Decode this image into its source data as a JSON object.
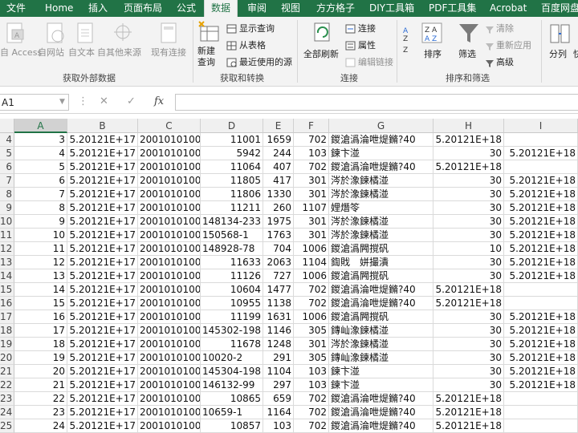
{
  "tabs": [
    "文件",
    "Home",
    "插入",
    "页面布局",
    "公式",
    "数据",
    "审阅",
    "视图",
    "方方格子",
    "DIY工具箱",
    "PDF工具集",
    "Acrobat",
    "百度网盘"
  ],
  "active_tab": "数据",
  "ribbon": {
    "ext_buttons": [
      "自 Access",
      "自网站",
      "自文本",
      "自其他来源",
      "现有连接"
    ],
    "group_external": "获取外部数据",
    "new_query": "新建\n查询",
    "get_cmds": [
      "显示查询",
      "从表格",
      "最近使用的源"
    ],
    "group_get": "获取和转换",
    "refresh_all": "全部刷新",
    "conn_cmds": [
      "连接",
      "属性",
      "编辑链接"
    ],
    "group_conn": "连接",
    "sort": "排序",
    "filter": "筛选",
    "filter_cmds": [
      "清除",
      "重新应用",
      "高级"
    ],
    "group_sort": "排序和筛选",
    "split": "分列",
    "more": "快"
  },
  "formula_bar": {
    "name_box": "A1",
    "fx": "fx",
    "formula": ""
  },
  "columns": [
    "A",
    "B",
    "C",
    "D",
    "E",
    "F",
    "G",
    "H",
    "I"
  ],
  "rows": [
    {
      "n": "4",
      "a": "3",
      "b": "5.20121E+17",
      "c": "2001010100",
      "d": "11001",
      "e": "1659",
      "f": "702",
      "g": "鍐滄潙淪呭煶鏅?40",
      "h": "5.20121E+18",
      "i": ""
    },
    {
      "n": "5",
      "a": "4",
      "b": "5.20121E+17",
      "c": "2001010100",
      "d": "5942",
      "e": "244",
      "f": "103",
      "g": "鍊卞湴",
      "h": "30",
      "i": "5.20121E+18"
    },
    {
      "n": "6",
      "a": "5",
      "b": "5.20121E+17",
      "c": "2001010100",
      "d": "11064",
      "e": "407",
      "f": "702",
      "g": "鍐滄潙淪呭煶鏅?40",
      "h": "5.20121E+18",
      "i": ""
    },
    {
      "n": "7",
      "a": "6",
      "b": "5.20121E+17",
      "c": "2001010100",
      "d": "11805",
      "e": "417",
      "f": "301",
      "g": "涔於潒鍊橘湴",
      "h": "30",
      "i": "5.20121E+18"
    },
    {
      "n": "8",
      "a": "7",
      "b": "5.20121E+17",
      "c": "2001010100",
      "d": "11806",
      "e": "1330",
      "f": "301",
      "g": "涔於潒鍊橘湴",
      "h": "30",
      "i": "5.20121E+18"
    },
    {
      "n": "9",
      "a": "8",
      "b": "5.20121E+17",
      "c": "2001010100",
      "d": "11211",
      "e": "260",
      "f": "1107",
      "g": "娌熸笭",
      "h": "30",
      "i": "5.20121E+18"
    },
    {
      "n": "10",
      "a": "9",
      "b": "5.20121E+17",
      "c": "2001010100",
      "d": "148134-233",
      "e": "1975",
      "f": "301",
      "g": "涔於潒鍊橘湴",
      "h": "30",
      "i": "5.20121E+18"
    },
    {
      "n": "11",
      "a": "10",
      "b": "5.20121E+17",
      "c": "2001010100",
      "d": "150568-1",
      "e": "1763",
      "f": "301",
      "g": "涔於潒鍊橘湴",
      "h": "30",
      "i": "5.20121E+18"
    },
    {
      "n": "12",
      "a": "11",
      "b": "5.20121E+17",
      "c": "2001010100",
      "d": "148928-78",
      "e": "704",
      "f": "1006",
      "g": "鍐滄潙闁撹矾",
      "h": "10",
      "i": "5.20121E+18"
    },
    {
      "n": "13",
      "a": "12",
      "b": "5.20121E+17",
      "c": "2001010100",
      "d": "11633",
      "e": "2063",
      "f": "1104",
      "g": "鍧戝　姘撮潰",
      "h": "30",
      "i": "5.20121E+18"
    },
    {
      "n": "14",
      "a": "13",
      "b": "5.20121E+17",
      "c": "2001010100",
      "d": "11126",
      "e": "727",
      "f": "1006",
      "g": "鍐滄潙闁撹矾",
      "h": "30",
      "i": "5.20121E+18"
    },
    {
      "n": "15",
      "a": "14",
      "b": "5.20121E+17",
      "c": "2001010100",
      "d": "10604",
      "e": "1477",
      "f": "702",
      "g": "鍐滄潙淪呭煶鏅?40",
      "h": "5.20121E+18",
      "i": ""
    },
    {
      "n": "16",
      "a": "15",
      "b": "5.20121E+17",
      "c": "2001010100",
      "d": "10955",
      "e": "1138",
      "f": "702",
      "g": "鍐滄潙淪呭煶鏅?40",
      "h": "5.20121E+18",
      "i": ""
    },
    {
      "n": "17",
      "a": "16",
      "b": "5.20121E+17",
      "c": "2001010100",
      "d": "11199",
      "e": "1631",
      "f": "1006",
      "g": "鍐滄潙闁撹矾",
      "h": "30",
      "i": "5.20121E+18"
    },
    {
      "n": "18",
      "a": "17",
      "b": "5.20121E+17",
      "c": "2001010100",
      "d": "145302-198",
      "e": "1146",
      "f": "305",
      "g": "鏄屾潒鍊橘湴",
      "h": "30",
      "i": "5.20121E+18"
    },
    {
      "n": "19",
      "a": "18",
      "b": "5.20121E+17",
      "c": "2001010100",
      "d": "11678",
      "e": "1248",
      "f": "301",
      "g": "涔於潒鍊橘湴",
      "h": "30",
      "i": "5.20121E+18"
    },
    {
      "n": "20",
      "a": "19",
      "b": "5.20121E+17",
      "c": "2001010100",
      "d": "10020-2",
      "e": "291",
      "f": "305",
      "g": "鏄屾潒鍊橘湴",
      "h": "30",
      "i": "5.20121E+18"
    },
    {
      "n": "21",
      "a": "20",
      "b": "5.20121E+17",
      "c": "2001010100",
      "d": "145304-198",
      "e": "1104",
      "f": "103",
      "g": "鍊卞湴",
      "h": "30",
      "i": "5.20121E+18"
    },
    {
      "n": "22",
      "a": "21",
      "b": "5.20121E+17",
      "c": "2001010100",
      "d": "146132-99",
      "e": "297",
      "f": "103",
      "g": "鍊卞湴",
      "h": "30",
      "i": "5.20121E+18"
    },
    {
      "n": "23",
      "a": "22",
      "b": "5.20121E+17",
      "c": "2001010100",
      "d": "10865",
      "e": "659",
      "f": "702",
      "g": "鍐滄潙淪呭煶鏅?40",
      "h": "5.20121E+18",
      "i": ""
    },
    {
      "n": "24",
      "a": "23",
      "b": "5.20121E+17",
      "c": "2001010100",
      "d": "10659-1",
      "e": "1164",
      "f": "702",
      "g": "鍐滄潙淪呭煶鏅?40",
      "h": "5.20121E+18",
      "i": ""
    },
    {
      "n": "25",
      "a": "24",
      "b": "5.20121E+17",
      "c": "2001010100",
      "d": "10857",
      "e": "103",
      "f": "702",
      "g": "鍐滄潙淪呭煶鏅?40",
      "h": "5.20121E+18",
      "i": ""
    }
  ]
}
